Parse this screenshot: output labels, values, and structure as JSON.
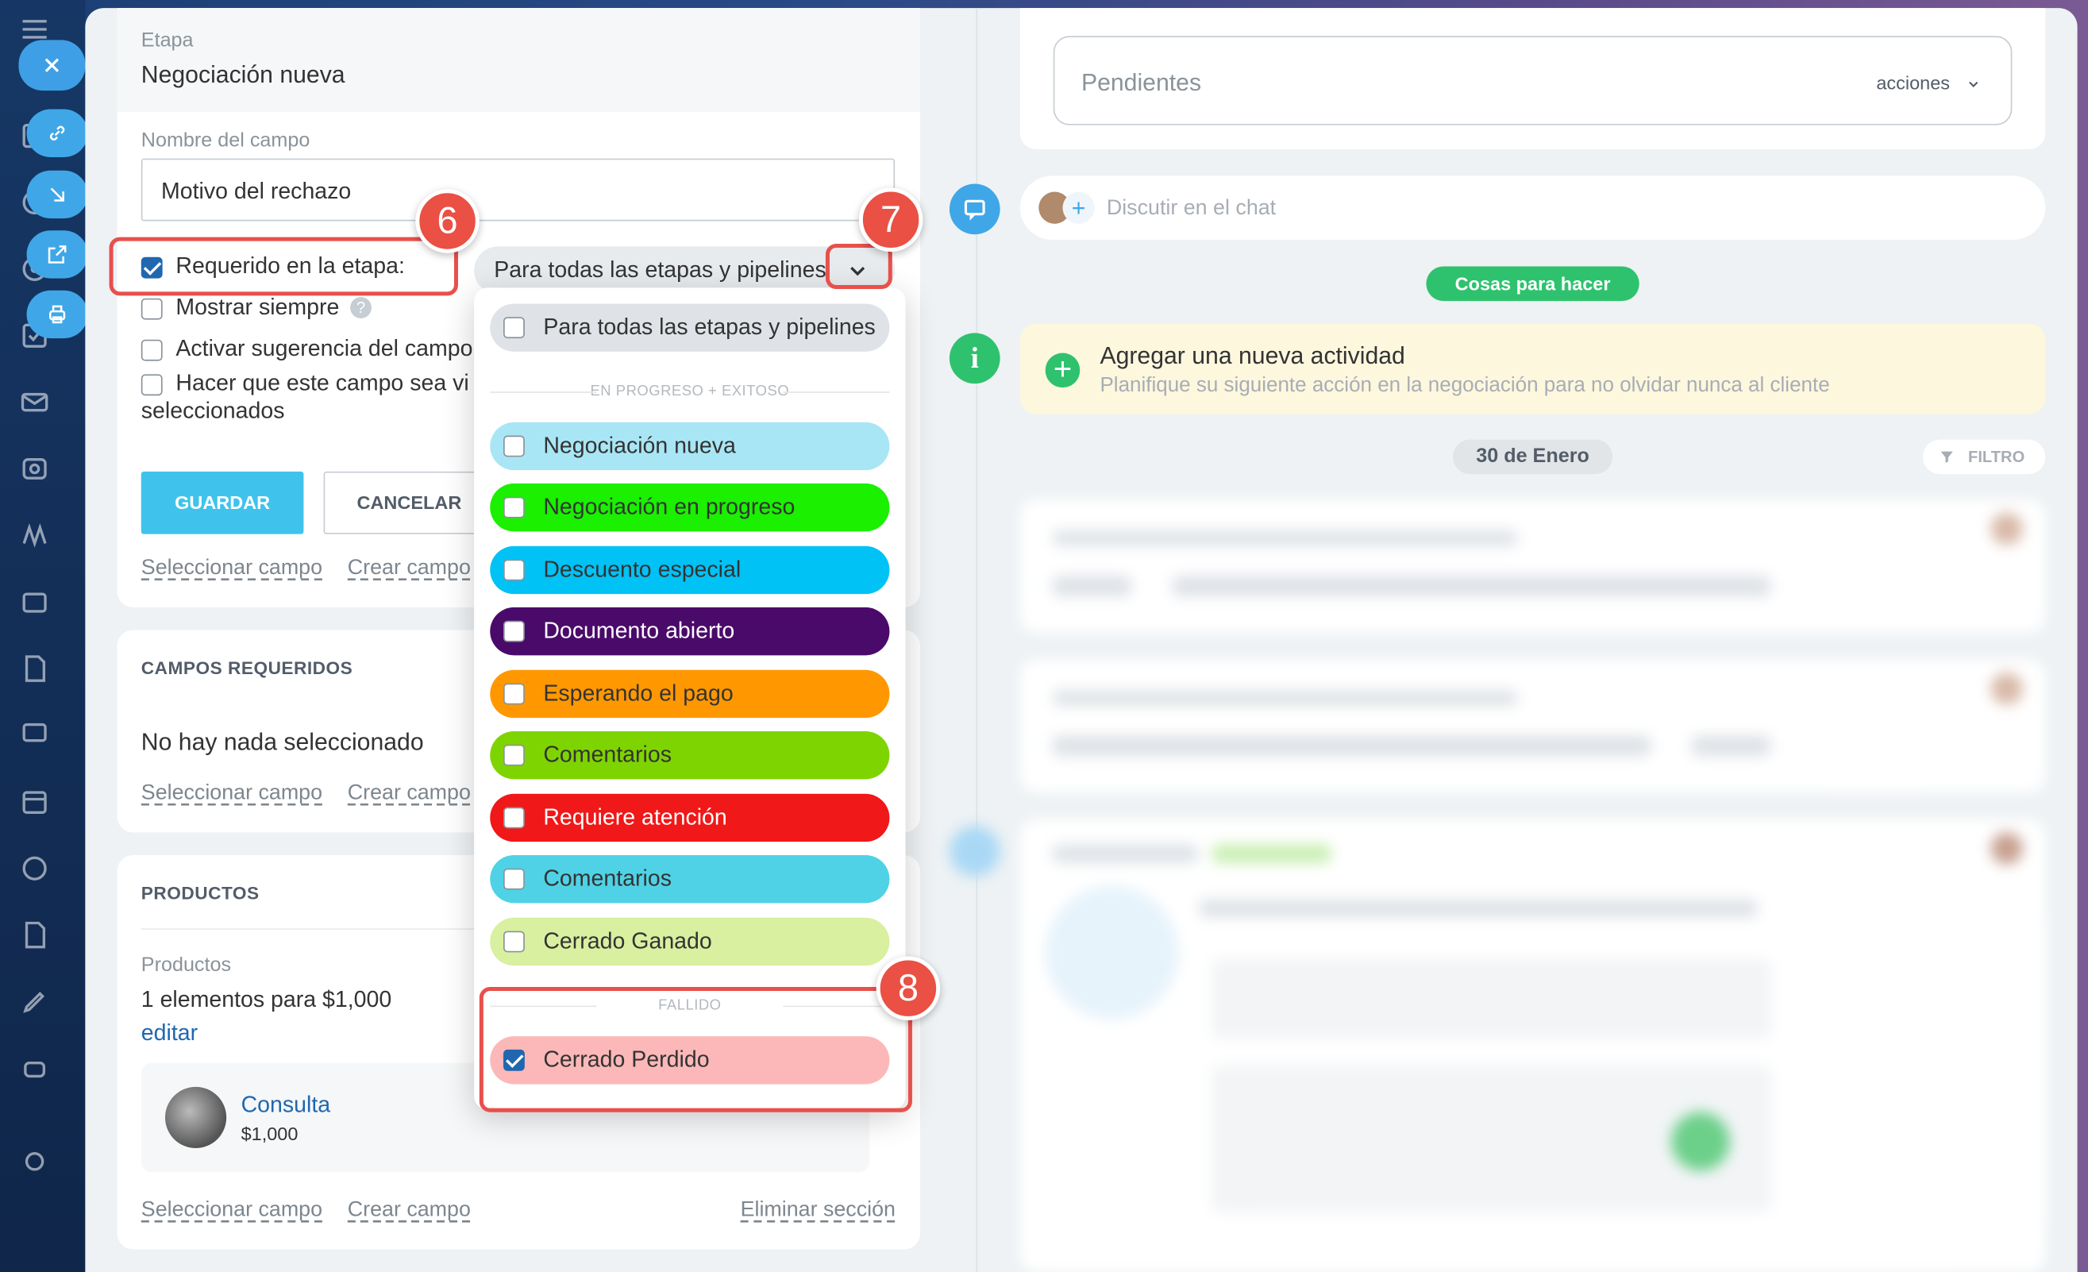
{
  "form": {
    "stage_label": "Etapa",
    "stage_value": "Negociación nueva",
    "field_name_label": "Nombre del campo",
    "field_name_value": "Motivo del rechazo",
    "required_label": "Requerido en la etapa:",
    "required_checked": true,
    "stage_select_value": "Para todas las etapas y pipelines",
    "show_always_label": "Mostrar siempre",
    "suggestion_label": "Activar sugerencia del campo",
    "visible_label_line1": "Hacer que este campo sea vi",
    "visible_label_line2": "seleccionados",
    "save_label": "GUARDAR",
    "cancel_label": "CANCELAR",
    "select_field": "Seleccionar campo",
    "create_field": "Crear campo"
  },
  "required_section": {
    "title": "CAMPOS REQUERIDOS",
    "empty_text": "No hay nada seleccionado",
    "select_field": "Seleccionar campo",
    "create_field": "Crear campo"
  },
  "products_section": {
    "title": "PRODUCTOS",
    "label": "Productos",
    "summary": "1 elementos para $1,000",
    "edit": "editar",
    "product_name": "Consulta",
    "product_price": "$1,000",
    "select_field": "Seleccionar campo",
    "create_field": "Crear campo",
    "delete_section": "Eliminar sección"
  },
  "dropdown": {
    "all_option": "Para todas las etapas y pipelines",
    "group_progress": "EN PROGRESO + EXITOSO",
    "group_failed": "FALLIDO",
    "options": [
      {
        "label": "Negociación nueva",
        "color": "#a9e6f5",
        "text": "#333333",
        "checked": false
      },
      {
        "label": "Negociación en progreso",
        "color": "#1af000",
        "text": "#333333",
        "checked": false
      },
      {
        "label": "Descuento especial",
        "color": "#00c2f5",
        "text": "#333333",
        "checked": false
      },
      {
        "label": "Documento abierto",
        "color": "#4a0a6a",
        "text": "#ffffff",
        "checked": false
      },
      {
        "label": "Esperando el pago",
        "color": "#ff9800",
        "text": "#333333",
        "checked": false
      },
      {
        "label": "Comentarios",
        "color": "#7ed400",
        "text": "#333333",
        "checked": false
      },
      {
        "label": "Requiere atención",
        "color": "#f01818",
        "text": "#ffffff",
        "checked": false
      },
      {
        "label": "Comentarios",
        "color": "#4fd2e6",
        "text": "#333333",
        "checked": false
      },
      {
        "label": "Cerrado Ganado",
        "color": "#d8f0a0",
        "text": "#333333",
        "checked": false
      }
    ],
    "failed_option": {
      "label": "Cerrado Perdido",
      "color": "#fcb8b8",
      "checked": true
    }
  },
  "badges": {
    "b6": "6",
    "b7": "7",
    "b8": "8"
  },
  "timeline": {
    "pending_label": "Pendientes",
    "actions_label": "acciones",
    "chat_placeholder": "Discutir en el chat",
    "todo_pill": "Cosas para hacer",
    "activity_title": "Agregar una nueva actividad",
    "activity_desc": "Planifique su siguiente acción en la negociación para no olvidar nunca al cliente",
    "date_pill": "30 de Enero",
    "filter_label": "FILTRO"
  },
  "icons": {
    "close": "close-icon",
    "link": "link-icon",
    "download": "download-icon",
    "external": "external-link-icon",
    "print": "printer-icon"
  }
}
